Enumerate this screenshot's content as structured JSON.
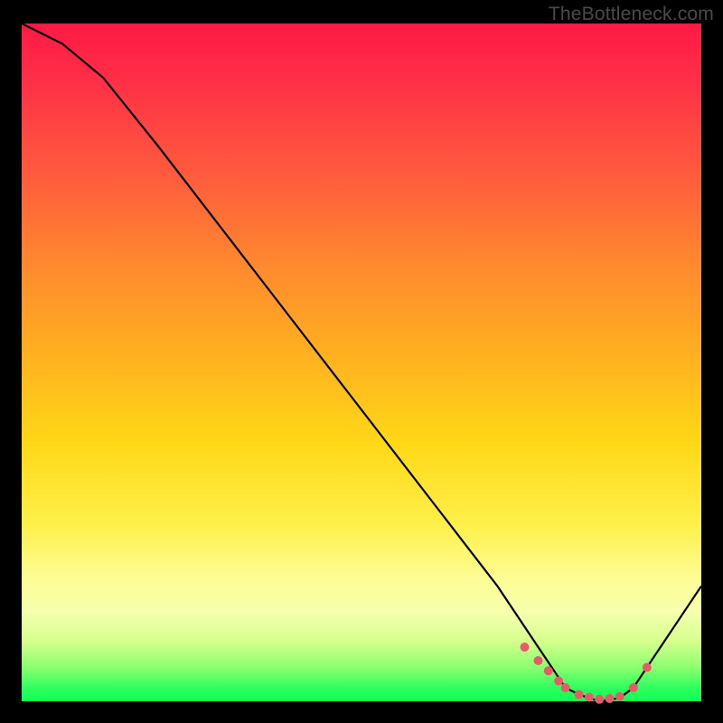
{
  "watermark": "TheBottleneck.com",
  "chart_data": {
    "type": "line",
    "title": "",
    "xlabel": "",
    "ylabel": "",
    "xlim": [
      0,
      100
    ],
    "ylim": [
      0,
      100
    ],
    "series": [
      {
        "name": "curve",
        "x": [
          0,
          6,
          12,
          20,
          30,
          40,
          50,
          60,
          70,
          76,
          78,
          80,
          82,
          85,
          88,
          90,
          92,
          100
        ],
        "values": [
          100,
          97,
          92,
          82,
          69,
          56,
          43,
          30,
          17,
          8,
          5,
          2,
          1,
          0,
          0.5,
          2,
          5,
          17
        ]
      }
    ],
    "markers": {
      "name": "minimum-cluster",
      "color": "#e85a6a",
      "x": [
        74,
        76,
        77.5,
        79,
        80,
        82,
        83.5,
        85,
        86.5,
        88,
        90,
        92
      ],
      "values": [
        8,
        6,
        4.5,
        3,
        2,
        1,
        0.6,
        0.3,
        0.4,
        0.7,
        2,
        5
      ]
    }
  }
}
